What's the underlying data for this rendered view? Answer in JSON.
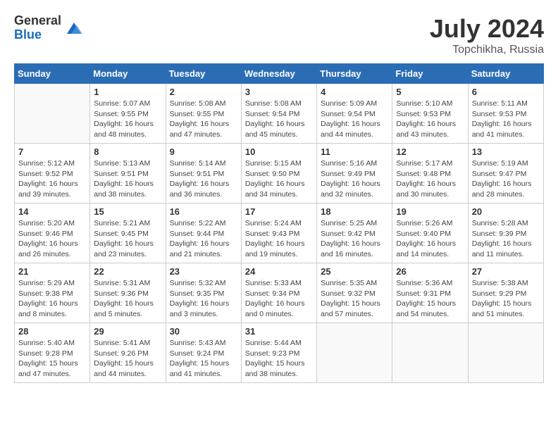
{
  "header": {
    "logo_general": "General",
    "logo_blue": "Blue",
    "month_title": "July 2024",
    "location": "Topchikha, Russia"
  },
  "days_of_week": [
    "Sunday",
    "Monday",
    "Tuesday",
    "Wednesday",
    "Thursday",
    "Friday",
    "Saturday"
  ],
  "weeks": [
    [
      {
        "day": "",
        "info": ""
      },
      {
        "day": "1",
        "info": "Sunrise: 5:07 AM\nSunset: 9:55 PM\nDaylight: 16 hours\nand 48 minutes."
      },
      {
        "day": "2",
        "info": "Sunrise: 5:08 AM\nSunset: 9:55 PM\nDaylight: 16 hours\nand 47 minutes."
      },
      {
        "day": "3",
        "info": "Sunrise: 5:08 AM\nSunset: 9:54 PM\nDaylight: 16 hours\nand 45 minutes."
      },
      {
        "day": "4",
        "info": "Sunrise: 5:09 AM\nSunset: 9:54 PM\nDaylight: 16 hours\nand 44 minutes."
      },
      {
        "day": "5",
        "info": "Sunrise: 5:10 AM\nSunset: 9:53 PM\nDaylight: 16 hours\nand 43 minutes."
      },
      {
        "day": "6",
        "info": "Sunrise: 5:11 AM\nSunset: 9:53 PM\nDaylight: 16 hours\nand 41 minutes."
      }
    ],
    [
      {
        "day": "7",
        "info": "Sunrise: 5:12 AM\nSunset: 9:52 PM\nDaylight: 16 hours\nand 39 minutes."
      },
      {
        "day": "8",
        "info": "Sunrise: 5:13 AM\nSunset: 9:51 PM\nDaylight: 16 hours\nand 38 minutes."
      },
      {
        "day": "9",
        "info": "Sunrise: 5:14 AM\nSunset: 9:51 PM\nDaylight: 16 hours\nand 36 minutes."
      },
      {
        "day": "10",
        "info": "Sunrise: 5:15 AM\nSunset: 9:50 PM\nDaylight: 16 hours\nand 34 minutes."
      },
      {
        "day": "11",
        "info": "Sunrise: 5:16 AM\nSunset: 9:49 PM\nDaylight: 16 hours\nand 32 minutes."
      },
      {
        "day": "12",
        "info": "Sunrise: 5:17 AM\nSunset: 9:48 PM\nDaylight: 16 hours\nand 30 minutes."
      },
      {
        "day": "13",
        "info": "Sunrise: 5:19 AM\nSunset: 9:47 PM\nDaylight: 16 hours\nand 28 minutes."
      }
    ],
    [
      {
        "day": "14",
        "info": "Sunrise: 5:20 AM\nSunset: 9:46 PM\nDaylight: 16 hours\nand 26 minutes."
      },
      {
        "day": "15",
        "info": "Sunrise: 5:21 AM\nSunset: 9:45 PM\nDaylight: 16 hours\nand 23 minutes."
      },
      {
        "day": "16",
        "info": "Sunrise: 5:22 AM\nSunset: 9:44 PM\nDaylight: 16 hours\nand 21 minutes."
      },
      {
        "day": "17",
        "info": "Sunrise: 5:24 AM\nSunset: 9:43 PM\nDaylight: 16 hours\nand 19 minutes."
      },
      {
        "day": "18",
        "info": "Sunrise: 5:25 AM\nSunset: 9:42 PM\nDaylight: 16 hours\nand 16 minutes."
      },
      {
        "day": "19",
        "info": "Sunrise: 5:26 AM\nSunset: 9:40 PM\nDaylight: 16 hours\nand 14 minutes."
      },
      {
        "day": "20",
        "info": "Sunrise: 5:28 AM\nSunset: 9:39 PM\nDaylight: 16 hours\nand 11 minutes."
      }
    ],
    [
      {
        "day": "21",
        "info": "Sunrise: 5:29 AM\nSunset: 9:38 PM\nDaylight: 16 hours\nand 8 minutes."
      },
      {
        "day": "22",
        "info": "Sunrise: 5:31 AM\nSunset: 9:36 PM\nDaylight: 16 hours\nand 5 minutes."
      },
      {
        "day": "23",
        "info": "Sunrise: 5:32 AM\nSunset: 9:35 PM\nDaylight: 16 hours\nand 3 minutes."
      },
      {
        "day": "24",
        "info": "Sunrise: 5:33 AM\nSunset: 9:34 PM\nDaylight: 16 hours\nand 0 minutes."
      },
      {
        "day": "25",
        "info": "Sunrise: 5:35 AM\nSunset: 9:32 PM\nDaylight: 15 hours\nand 57 minutes."
      },
      {
        "day": "26",
        "info": "Sunrise: 5:36 AM\nSunset: 9:31 PM\nDaylight: 15 hours\nand 54 minutes."
      },
      {
        "day": "27",
        "info": "Sunrise: 5:38 AM\nSunset: 9:29 PM\nDaylight: 15 hours\nand 51 minutes."
      }
    ],
    [
      {
        "day": "28",
        "info": "Sunrise: 5:40 AM\nSunset: 9:28 PM\nDaylight: 15 hours\nand 47 minutes."
      },
      {
        "day": "29",
        "info": "Sunrise: 5:41 AM\nSunset: 9:26 PM\nDaylight: 15 hours\nand 44 minutes."
      },
      {
        "day": "30",
        "info": "Sunrise: 5:43 AM\nSunset: 9:24 PM\nDaylight: 15 hours\nand 41 minutes."
      },
      {
        "day": "31",
        "info": "Sunrise: 5:44 AM\nSunset: 9:23 PM\nDaylight: 15 hours\nand 38 minutes."
      },
      {
        "day": "",
        "info": ""
      },
      {
        "day": "",
        "info": ""
      },
      {
        "day": "",
        "info": ""
      }
    ]
  ]
}
